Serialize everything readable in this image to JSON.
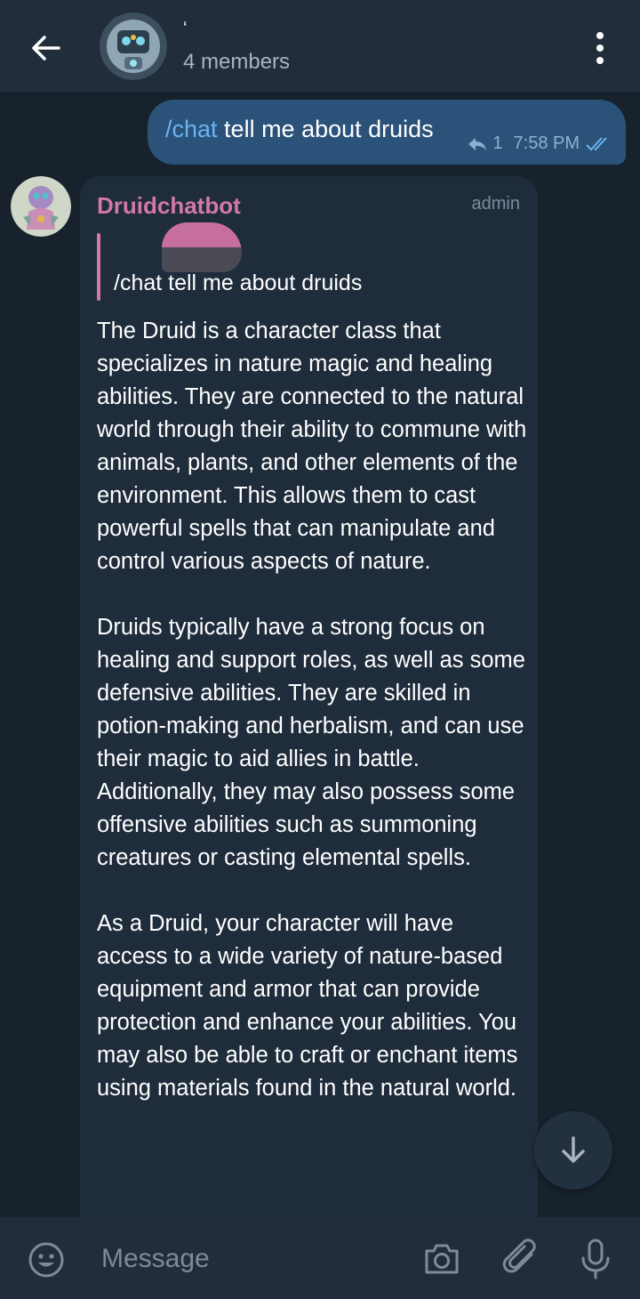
{
  "header": {
    "title": "ʻ",
    "subtitle": "4 members",
    "icons": {
      "back": "arrow-left-icon",
      "menu": "more-vertical-icon"
    }
  },
  "outgoing_message": {
    "command": "/chat",
    "text": " tell me about druids",
    "reply_count": "1",
    "time": "7:58 PM",
    "status": "double-check-icon"
  },
  "incoming_message": {
    "sender": "Druidchatbot",
    "role": "admin",
    "reply_quote": "/chat tell me about druids",
    "paragraphs": [
      "The Druid is a character class that specializes in nature magic and healing abilities. They are connected to the natural world through their ability to commune with animals, plants, and other elements of the environment. This allows them to cast powerful spells that can manipulate and control various aspects of nature.",
      "Druids typically have a strong focus on healing and support roles, as well as some defensive abilities. They are skilled in potion-making and herbalism, and can use their magic to aid allies in battle. Additionally, they may also possess some offensive abilities such as summoning creatures or casting elemental spells.",
      "As a Druid, your character will have access to a wide variety of nature-based equipment and armor that can provide protection and enhance your abilities. You may also be able to craft or enchant items using materials found in the natural world."
    ]
  },
  "composer": {
    "placeholder": "Message",
    "icons": [
      "emoji-icon",
      "camera-icon",
      "paperclip-icon",
      "microphone-icon"
    ]
  },
  "colors": {
    "header_bg": "#212d3b",
    "chat_bg": "#18222d",
    "outgoing_bubble": "#2b5278",
    "incoming_bubble": "#1f2c3b",
    "link_blue": "#6ab3f3",
    "sender_pink": "#d279a6"
  }
}
